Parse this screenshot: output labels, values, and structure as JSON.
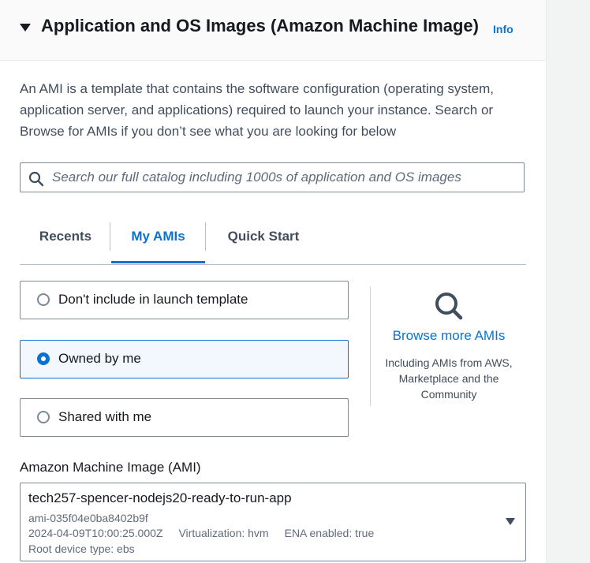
{
  "section": {
    "title": "Application and OS Images (Amazon Machine Image)",
    "info_label": "Info",
    "description": "An AMI is a template that contains the software configuration (operating system, application server, and applications) required to launch your instance. Search or Browse for AMIs if you don’t see what you are looking for below"
  },
  "search": {
    "value": "",
    "placeholder": "Search our full catalog including 1000s of application and OS images"
  },
  "tabs": [
    {
      "label": "Recents",
      "active": false
    },
    {
      "label": "My AMIs",
      "active": true
    },
    {
      "label": "Quick Start",
      "active": false
    }
  ],
  "ownership_options": [
    {
      "label": "Don't include in launch template",
      "selected": false
    },
    {
      "label": "Owned by me",
      "selected": true
    },
    {
      "label": "Shared with me",
      "selected": false
    }
  ],
  "browse": {
    "link_label": "Browse more AMIs",
    "note": "Including AMIs from AWS, Marketplace and the Community"
  },
  "ami": {
    "label": "Amazon Machine Image (AMI)",
    "name": "tech257-spencer-nodejs20-ready-to-run-app",
    "id": "ami-035f04e0ba8402b9f",
    "created": "2024-04-09T10:00:25.000Z",
    "virtualization": "Virtualization: hvm",
    "ena": "ENA enabled: true",
    "root_device": "Root device type: ebs"
  },
  "colors": {
    "accent": "#0972d3",
    "selected_bg": "#f2f8fd",
    "text": "#16191f",
    "muted": "#5f6b7a"
  }
}
